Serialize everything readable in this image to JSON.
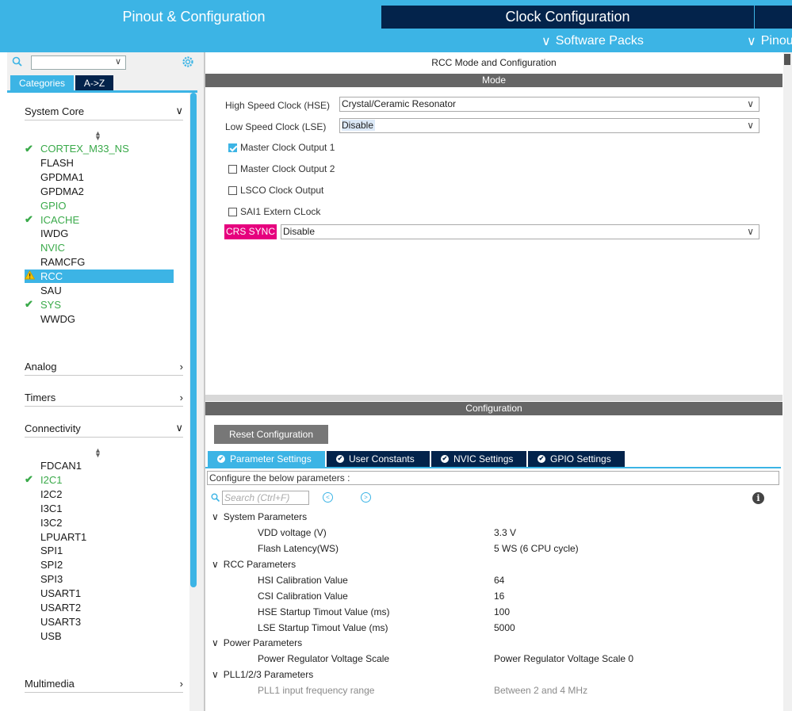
{
  "top_tabs": {
    "pinout": "Pinout & Configuration",
    "clock": "Clock Configuration"
  },
  "sub_tabs": {
    "software_packs": "Software Packs",
    "pinout": "Pinou"
  },
  "left": {
    "categories": "Categories",
    "az": "A->Z",
    "groups": {
      "system_core": "System Core",
      "analog": "Analog",
      "timers": "Timers",
      "connectivity": "Connectivity",
      "multimedia": "Multimedia"
    },
    "system_core_items": [
      {
        "label": "CORTEX_M33_NS",
        "status": "ok"
      },
      {
        "label": "FLASH",
        "status": ""
      },
      {
        "label": "GPDMA1",
        "status": ""
      },
      {
        "label": "GPDMA2",
        "status": ""
      },
      {
        "label": "GPIO",
        "status": "green"
      },
      {
        "label": "ICACHE",
        "status": "ok"
      },
      {
        "label": "IWDG",
        "status": ""
      },
      {
        "label": "NVIC",
        "status": "green"
      },
      {
        "label": "RAMCFG",
        "status": ""
      },
      {
        "label": "RCC",
        "status": "warning"
      },
      {
        "label": "SAU",
        "status": ""
      },
      {
        "label": "SYS",
        "status": "ok"
      },
      {
        "label": "WWDG",
        "status": ""
      }
    ],
    "connectivity_items": [
      {
        "label": "FDCAN1",
        "status": ""
      },
      {
        "label": "I2C1",
        "status": "ok"
      },
      {
        "label": "I2C2",
        "status": ""
      },
      {
        "label": "I3C1",
        "status": ""
      },
      {
        "label": "I3C2",
        "status": ""
      },
      {
        "label": "LPUART1",
        "status": ""
      },
      {
        "label": "SPI1",
        "status": ""
      },
      {
        "label": "SPI2",
        "status": ""
      },
      {
        "label": "SPI3",
        "status": ""
      },
      {
        "label": "USART1",
        "status": ""
      },
      {
        "label": "USART2",
        "status": ""
      },
      {
        "label": "USART3",
        "status": ""
      },
      {
        "label": "USB",
        "status": ""
      }
    ]
  },
  "mode": {
    "title": "RCC Mode and Configuration",
    "bar": "Mode",
    "hse_label": "High Speed Clock (HSE)",
    "hse_value": "Crystal/Ceramic Resonator",
    "lse_label": "Low Speed Clock (LSE)",
    "lse_value": "Disable",
    "checkboxes": [
      {
        "label": "Master Clock Output 1",
        "checked": true
      },
      {
        "label": "Master Clock Output 2",
        "checked": false
      },
      {
        "label": "LSCO Clock Output",
        "checked": false
      },
      {
        "label": "SAI1 Extern CLock",
        "checked": false
      }
    ],
    "crs_label": "CRS SYNC",
    "crs_value": "Disable"
  },
  "config": {
    "bar": "Configuration",
    "reset": "Reset Configuration",
    "tabs": [
      "Parameter Settings",
      "User Constants",
      "NVIC Settings",
      "GPIO Settings"
    ],
    "desc": "Configure the below parameters :",
    "search_placeholder": "Search (Ctrl+F)",
    "sections": {
      "system": "System Parameters",
      "rcc": "RCC Parameters",
      "power": "Power Parameters",
      "pll": "PLL1/2/3 Parameters"
    },
    "params": {
      "vdd": {
        "name": "VDD voltage (V)",
        "value": "3.3 V"
      },
      "flash": {
        "name": "Flash Latency(WS)",
        "value": "5 WS (6 CPU cycle)"
      },
      "hsi": {
        "name": "HSI Calibration Value",
        "value": "64"
      },
      "csi": {
        "name": "CSI Calibration Value",
        "value": "16"
      },
      "hse_t": {
        "name": "HSE Startup Timout Value (ms)",
        "value": "100"
      },
      "lse_t": {
        "name": "LSE Startup Timout Value (ms)",
        "value": "5000"
      },
      "pwr": {
        "name": "Power Regulator Voltage Scale",
        "value": "Power Regulator Voltage Scale 0"
      },
      "pll": {
        "name": "PLL1 input frequency range",
        "value": "Between 2 and 4 MHz"
      }
    }
  },
  "colors": {
    "accent": "#3cb4e5",
    "navy": "#03234b",
    "ok_green": "#3aaa4a",
    "crs_magenta": "#e6007e"
  }
}
